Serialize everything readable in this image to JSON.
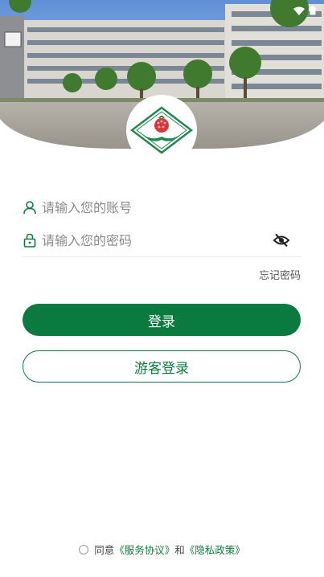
{
  "login": {
    "account_placeholder": "请输入您的账号",
    "password_placeholder": "请输入您的密码",
    "forgot_password": "忘记密码",
    "login_button": "登录",
    "guest_button": "游客登录"
  },
  "agreement": {
    "prefix": "同意",
    "service_link": "《服务协议》",
    "and": "和",
    "privacy_link": "《隐私政策》"
  },
  "theme": {
    "accent": "#0b7a3e"
  },
  "icons": [
    "user-icon",
    "lock-icon",
    "eye-off-icon",
    "wifi-icon",
    "battery-icon"
  ]
}
